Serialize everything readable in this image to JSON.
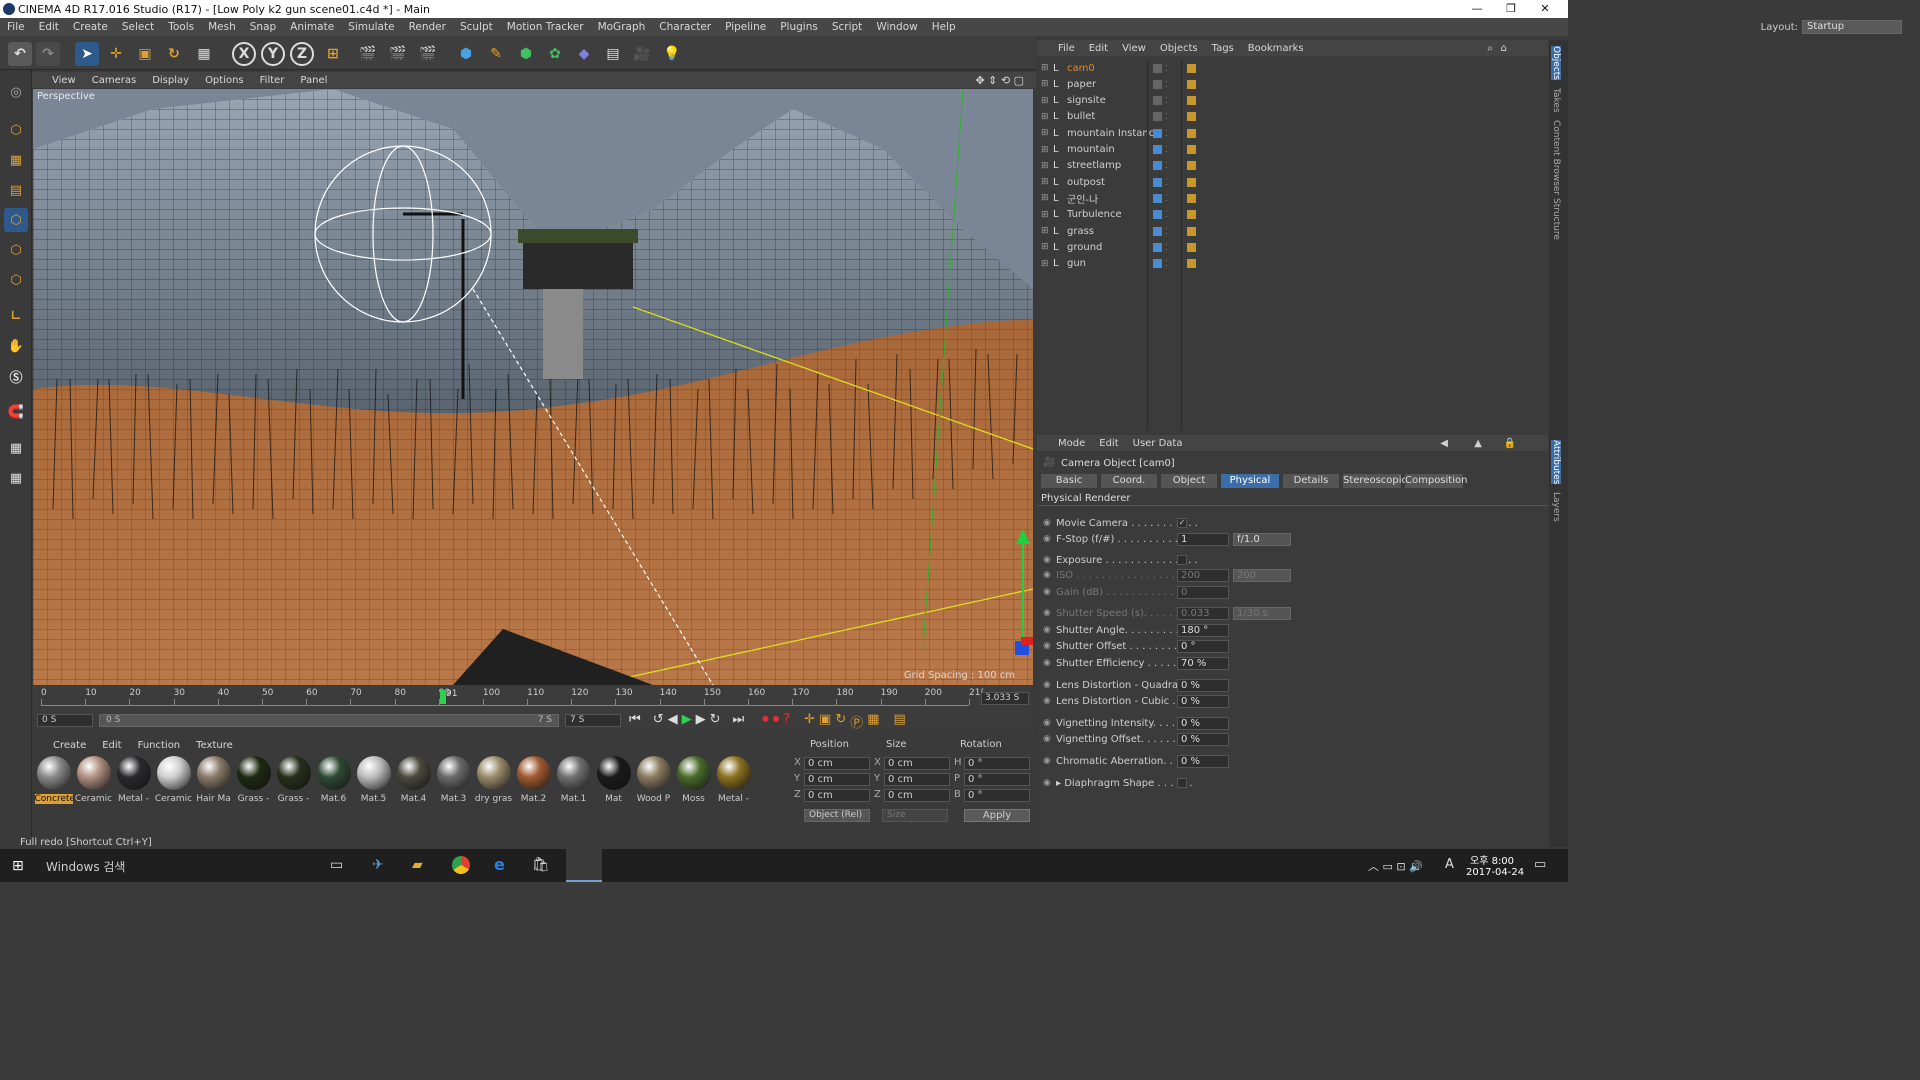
{
  "window": {
    "title": "CINEMA 4D R17.016 Studio (R17) - [Low Poly k2 gun scene01.c4d *] - Main",
    "controls": [
      "—",
      "❐",
      "✕"
    ]
  },
  "menubar": {
    "items": [
      "File",
      "Edit",
      "Create",
      "Select",
      "Tools",
      "Mesh",
      "Snap",
      "Animate",
      "Simulate",
      "Render",
      "Sculpt",
      "Motion Tracker",
      "MoGraph",
      "Character",
      "Pipeline",
      "Plugins",
      "Script",
      "Window",
      "Help"
    ],
    "layout_label": "Layout:",
    "layout_value": "Startup"
  },
  "toolbar": {
    "axis_x": "X",
    "axis_y": "Y",
    "axis_z": "Z"
  },
  "viewport": {
    "menu": [
      "View",
      "Cameras",
      "Display",
      "Options",
      "Filter",
      "Panel"
    ],
    "label": "Perspective",
    "grid_spacing": "Grid Spacing : 100 cm"
  },
  "timeline": {
    "ticks": [
      "0",
      "10",
      "20",
      "30",
      "40",
      "50",
      "60",
      "70",
      "80",
      "90",
      "100",
      "110",
      "120",
      "130",
      "140",
      "150",
      "160",
      "170",
      "180",
      "190",
      "200",
      "21("
    ],
    "current_frame": "91",
    "current_frame_fraction": 0.43,
    "end_time": "3.033 S",
    "start_field": "0 S",
    "range_start": "0 S",
    "range_end": "7 S",
    "end_field": "7 S"
  },
  "materials": {
    "menu": [
      "Create",
      "Edit",
      "Function",
      "Texture"
    ],
    "items": [
      {
        "label": "Concrete",
        "color": "#8a8a8a"
      },
      {
        "label": "Ceramic",
        "color": "#b09080"
      },
      {
        "label": "Metal -",
        "color": "#2a2a2e"
      },
      {
        "label": "Ceramic",
        "color": "#d0d0d0"
      },
      {
        "label": "Hair Ma",
        "color": "#8a7a6a"
      },
      {
        "label": "Grass -",
        "color": "#1e2a12"
      },
      {
        "label": "Grass -",
        "color": "#26301a"
      },
      {
        "label": "Mat.6",
        "color": "#2f4a36"
      },
      {
        "label": "Mat.5",
        "color": "#bdbdbd"
      },
      {
        "label": "Mat.4",
        "color": "#4a4a40"
      },
      {
        "label": "Mat.3",
        "color": "#6a6a6a"
      },
      {
        "label": "dry gras",
        "color": "#9a8a6a"
      },
      {
        "label": "Mat.2",
        "color": "#a05a30"
      },
      {
        "label": "Mat.1",
        "color": "#707070"
      },
      {
        "label": "Mat",
        "color": "#1a1a1a"
      },
      {
        "label": "Wood P",
        "color": "#8a7a60"
      },
      {
        "label": "Moss",
        "color": "#4a6a2a"
      },
      {
        "label": "Metal -",
        "color": "#8a7020"
      }
    ]
  },
  "coords": {
    "headers": [
      "Position",
      "Size",
      "Rotation"
    ],
    "rows": [
      {
        "axis": "X",
        "pos": "0 cm",
        "size_axis": "X",
        "size": "0 cm",
        "rot_axis": "H",
        "rot": "0 °"
      },
      {
        "axis": "Y",
        "pos": "0 cm",
        "size_axis": "Y",
        "size": "0 cm",
        "rot_axis": "P",
        "rot": "0 °"
      },
      {
        "axis": "Z",
        "pos": "0 cm",
        "size_axis": "Z",
        "size": "0 cm",
        "rot_axis": "B",
        "rot": "0 °"
      }
    ],
    "mode": "Object (Rel)",
    "size_mode": "Size",
    "apply": "Apply"
  },
  "status": {
    "text": "Full redo [Shortcut Ctrl+Y]"
  },
  "objects": {
    "menu": [
      "File",
      "Edit",
      "View",
      "Objects",
      "Tags",
      "Bookmarks"
    ],
    "items": [
      {
        "name": "cam0",
        "selected": true
      },
      {
        "name": "paper"
      },
      {
        "name": "signsite"
      },
      {
        "name": "bullet"
      },
      {
        "name": "mountain Instance"
      },
      {
        "name": "mountain"
      },
      {
        "name": "streetlamp"
      },
      {
        "name": "outpost"
      },
      {
        "name": "군인-나"
      },
      {
        "name": "Turbulence"
      },
      {
        "name": "grass"
      },
      {
        "name": "ground"
      },
      {
        "name": "gun"
      }
    ]
  },
  "attributes": {
    "menu": [
      "Mode",
      "Edit",
      "User Data"
    ],
    "object_title": "Camera Object [cam0]",
    "tabs": [
      "Basic",
      "Coord.",
      "Object",
      "Physical",
      "Details",
      "Stereoscopic",
      "Composition"
    ],
    "active_tab": "Physical",
    "section": "Physical Renderer",
    "rows": [
      {
        "label": "Movie Camera . . . . . . . . . . .",
        "check": "✓"
      },
      {
        "label": "F-Stop (f/#) . . . . . . . . . . . . .",
        "value": "1",
        "extra": "f/1.0"
      },
      {
        "label": "Exposure . . . . . . . . . . . . . . .",
        "check": ""
      },
      {
        "label": "ISO . . . . . . . . . . . . . . . . . . .",
        "value": "200",
        "extra": "200",
        "dim": true
      },
      {
        "label": "Gain (dB) . . . . . . . . . . . . . . .",
        "value": "0",
        "dim": true
      },
      {
        "label": "Shutter Speed (s). . . . . . . . . .",
        "value": "0.033",
        "extra": "1/30 s",
        "dim": true
      },
      {
        "label": "Shutter Angle. . . . . . . . . . . .",
        "value": "180 °"
      },
      {
        "label": "Shutter Offset . . . . . . . . . . .",
        "value": "0 °"
      },
      {
        "label": "Shutter Efficiency . . . . . . . . .",
        "value": "70 %"
      },
      {
        "label": "Lens Distortion - Quadratic",
        "value": "0 %"
      },
      {
        "label": "Lens Distortion - Cubic . . .",
        "value": "0 %"
      },
      {
        "label": "Vignetting Intensity. . . . . . .",
        "value": "0 %"
      },
      {
        "label": "Vignetting Offset. . . . . . . . .",
        "value": "0 %"
      },
      {
        "label": "Chromatic Aberration. . . . . .",
        "value": "0 %"
      },
      {
        "label": "▸ Diaphragm Shape . . . . . .",
        "check": ""
      }
    ]
  },
  "side_tabs": [
    "Objects",
    "Takes",
    "Content Browser",
    "Structure",
    "Attributes",
    "Layers"
  ],
  "taskbar": {
    "search_placeholder": "Windows 검색",
    "time": "오후 8:00",
    "date": "2017-04-24",
    "ime": "A"
  },
  "colors": {
    "accent": "#3b6ea8",
    "ui_bg": "#3b3b3b",
    "selected_object": "#e08a2a"
  }
}
